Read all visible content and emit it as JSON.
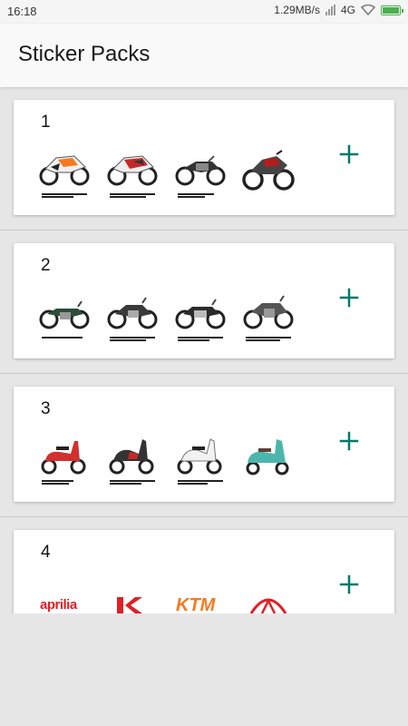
{
  "status_bar": {
    "time": "16:18",
    "net_speed": "1.29MB/s",
    "network": "4G"
  },
  "app_bar": {
    "title": "Sticker Packs"
  },
  "packs": [
    {
      "name": "1",
      "stickers": [
        "sport-bike-sticker",
        "sport-bike-sticker",
        "naked-bike-sticker",
        "street-bike-sticker"
      ]
    },
    {
      "name": "2",
      "stickers": [
        "cruiser-bike-sticker",
        "cruiser-bike-sticker",
        "cruiser-bike-sticker",
        "cruiser-bike-sticker"
      ]
    },
    {
      "name": "3",
      "stickers": [
        "scooter-sticker",
        "scooter-sticker",
        "scooter-sticker",
        "scooter-sticker"
      ]
    },
    {
      "name": "4",
      "stickers": [
        "aprilia-logo",
        "kawasaki-logo",
        "ktm-logo",
        "mahindra-logo"
      ]
    }
  ],
  "brands": {
    "aprilia": "aprilia",
    "ktm": "KTM"
  },
  "colors": {
    "accent": "#00796b",
    "brand_red": "#e01f26",
    "ktm_orange": "#f47a20"
  },
  "icons": {
    "add": "plus-icon"
  }
}
